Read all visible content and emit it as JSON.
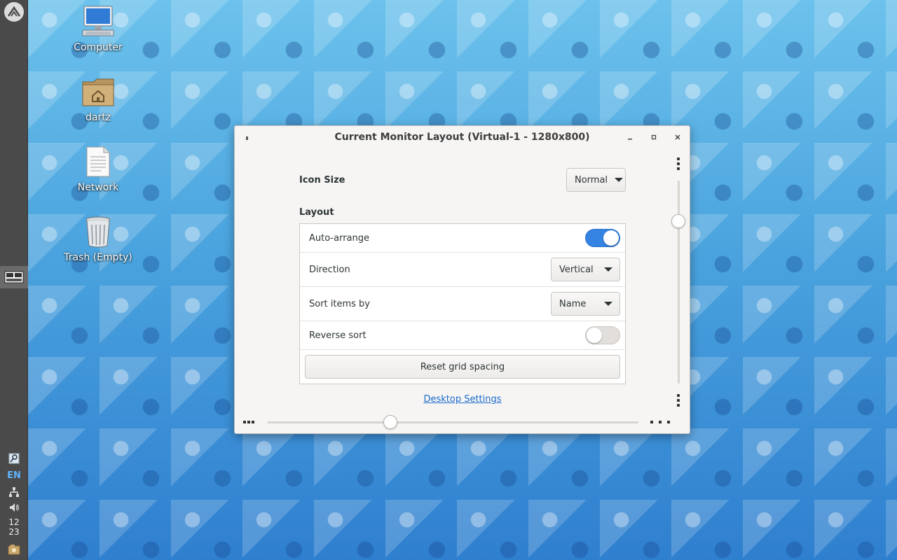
{
  "panel": {
    "menu_icon": "distro-logo-icon",
    "task_icon": "window-list-icon",
    "tray": {
      "lang": "EN",
      "clock_hour": "12",
      "clock_minute": "23"
    }
  },
  "desktop": {
    "icons": [
      {
        "label": "Computer",
        "icon": "computer-icon"
      },
      {
        "label": "dartz",
        "icon": "home-folder-icon"
      },
      {
        "label": "Network",
        "icon": "network-icon"
      },
      {
        "label": "Trash (Empty)",
        "icon": "trash-icon"
      }
    ]
  },
  "dialog": {
    "title": "Current Monitor Layout (Virtual-1 - 1280x800)",
    "icon_size_label": "Icon Size",
    "icon_size_value": "Normal",
    "layout_label": "Layout",
    "auto_arrange_label": "Auto-arrange",
    "auto_arrange_on": true,
    "direction_label": "Direction",
    "direction_value": "Vertical",
    "sort_label": "Sort items by",
    "sort_value": "Name",
    "reverse_label": "Reverse sort",
    "reverse_on": false,
    "reset_label": "Reset grid spacing",
    "settings_link": "Desktop Settings"
  },
  "colors": {
    "accent": "#3584e4",
    "link": "#1b6acb",
    "panel": "#4a4a4a"
  }
}
